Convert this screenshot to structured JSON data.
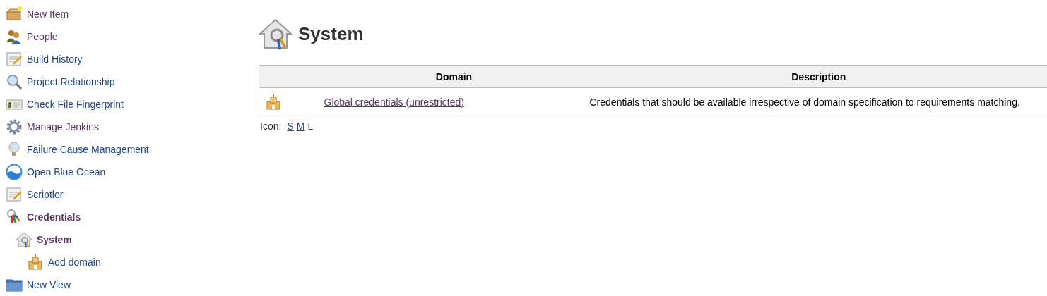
{
  "sidebar": {
    "items": [
      {
        "label": "New Item",
        "kind": "box",
        "selected": false,
        "visited": true
      },
      {
        "label": "People",
        "kind": "people",
        "selected": false,
        "visited": true
      },
      {
        "label": "Build History",
        "kind": "notepad",
        "selected": false,
        "visited": false
      },
      {
        "label": "Project Relationship",
        "kind": "magnifier",
        "selected": false,
        "visited": false
      },
      {
        "label": "Check File Fingerprint",
        "kind": "card",
        "selected": false,
        "visited": false
      },
      {
        "label": "Manage Jenkins",
        "kind": "gear",
        "selected": false,
        "visited": true
      },
      {
        "label": "Failure Cause Management",
        "kind": "bulb",
        "selected": false,
        "visited": false
      },
      {
        "label": "Open Blue Ocean",
        "kind": "ocean",
        "selected": false,
        "visited": false
      },
      {
        "label": "Scriptler",
        "kind": "notepad",
        "selected": false,
        "visited": false
      },
      {
        "label": "Credentials",
        "kind": "keys",
        "selected": true,
        "children": [
          {
            "label": "System",
            "kind": "house",
            "selected": true,
            "children": [
              {
                "label": "Add domain",
                "kind": "castle",
                "selected": false,
                "visited": false
              }
            ]
          }
        ]
      },
      {
        "label": "New View",
        "kind": "folder",
        "selected": false,
        "visited": false
      }
    ]
  },
  "page": {
    "title": "System"
  },
  "table": {
    "columns": [
      "Domain",
      "Description"
    ],
    "rows": [
      {
        "domain": "Global credentials (unrestricted)",
        "description": "Credentials that should be available irrespective of domain specification to requirements matching."
      }
    ]
  },
  "icon_size": {
    "label": "Icon:",
    "options": [
      {
        "label": "S",
        "selected": false
      },
      {
        "label": "M",
        "selected": false
      },
      {
        "label": "L",
        "selected": true
      }
    ]
  }
}
